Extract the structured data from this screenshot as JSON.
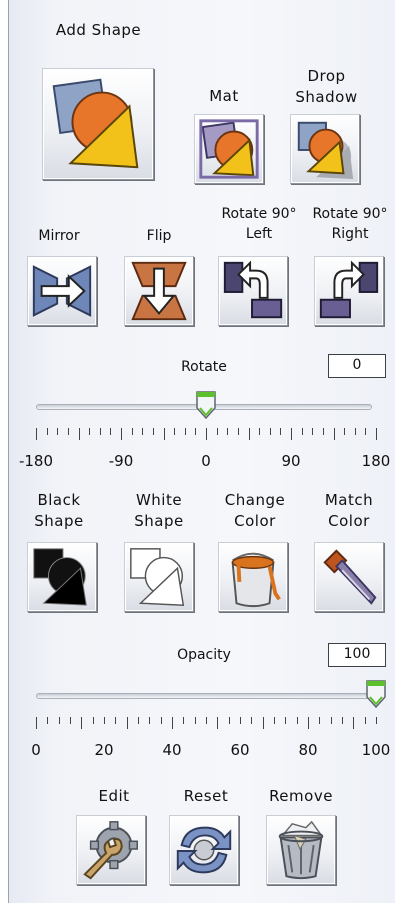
{
  "shape_tools": {
    "add_shape_label": "Add Shape",
    "mat_label": "Mat",
    "drop_shadow_label": "Drop Shadow"
  },
  "transform_tools": {
    "mirror_label": "Mirror",
    "flip_label": "Flip",
    "rotate_left_label": "Rotate 90° Left",
    "rotate_right_label": "Rotate 90° Right"
  },
  "rotate": {
    "label": "Rotate",
    "value": "0",
    "min": -180,
    "max": 180,
    "current": 0,
    "scale_labels": [
      "-180",
      "-90",
      "0",
      "90",
      "180"
    ]
  },
  "color_tools": {
    "black_shape_label": "Black Shape",
    "white_shape_label": "White Shape",
    "change_color_label": "Change Color",
    "match_color_label": "Match Color"
  },
  "opacity": {
    "label": "Opacity",
    "value": "100",
    "min": 0,
    "max": 100,
    "current": 100,
    "scale_labels": [
      "0",
      "20",
      "40",
      "60",
      "80",
      "100"
    ]
  },
  "actions": {
    "edit_label": "Edit",
    "reset_label": "Reset",
    "remove_label": "Remove"
  },
  "colors": {
    "accent_orange": "#e8762a",
    "accent_yellow": "#f2c21a",
    "slider_thumb_green": "#5dc02c",
    "panel_background": "#f1f3f8"
  },
  "icons": [
    "add-shape-icon",
    "mat-icon",
    "drop-shadow-icon",
    "mirror-icon",
    "flip-icon",
    "rotate-left-icon",
    "rotate-right-icon",
    "black-shape-icon",
    "white-shape-icon",
    "paint-bucket-icon",
    "eyedropper-icon",
    "gear-wrench-icon",
    "reset-arrows-icon",
    "trash-can-icon"
  ]
}
